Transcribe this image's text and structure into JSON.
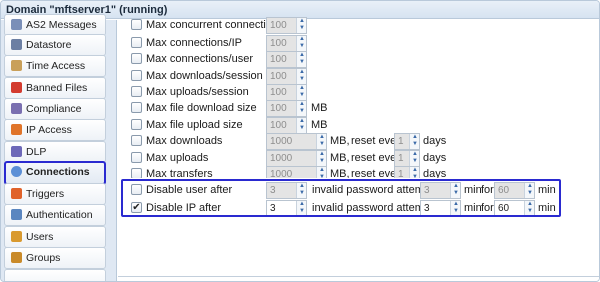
{
  "window": {
    "title": "Domain \"mftserver1\" (running)"
  },
  "sidebar": {
    "items": [
      {
        "label": "AS2 Messages",
        "icon": "as2-messages-icon",
        "color": "#7a8fb8"
      },
      {
        "label": "Datastore",
        "icon": "datastore-icon",
        "color": "#6c7fa3"
      },
      {
        "label": "Time Access",
        "icon": "time-access-icon",
        "color": "#c9a05a"
      },
      {
        "label": "Banned Files",
        "icon": "banned-files-icon",
        "color": "#d33b2f"
      },
      {
        "label": "Compliance",
        "icon": "compliance-icon",
        "color": "#7a6fb0"
      },
      {
        "label": "IP Access",
        "icon": "ip-access-icon",
        "color": "#e0742a"
      },
      {
        "label": "DLP",
        "icon": "dlp-icon",
        "color": "#6d68b8"
      },
      {
        "label": "Connections",
        "icon": "connections-icon",
        "color": "#5c8fd6",
        "active": true
      },
      {
        "label": "Triggers",
        "icon": "triggers-icon",
        "color": "#e0622a"
      },
      {
        "label": "Authentication",
        "icon": "authentication-icon",
        "color": "#5a86c0"
      },
      {
        "label": "Users",
        "icon": "users-icon",
        "color": "#d99a30"
      },
      {
        "label": "Groups",
        "icon": "groups-icon",
        "color": "#c98a2a"
      }
    ]
  },
  "settings": {
    "max_concurrent_connections": {
      "label": "Max concurrent connections",
      "value": "100"
    },
    "max_connections_ip": {
      "label": "Max connections/IP",
      "value": "100"
    },
    "max_connections_user": {
      "label": "Max connections/user",
      "value": "100"
    },
    "max_downloads_session": {
      "label": "Max downloads/session",
      "value": "100"
    },
    "max_uploads_session": {
      "label": "Max uploads/session",
      "value": "100"
    },
    "max_file_download_size": {
      "label": "Max file download size",
      "value": "100",
      "unit": "MB"
    },
    "max_file_upload_size": {
      "label": "Max file upload size",
      "value": "100",
      "unit": "MB"
    },
    "max_downloads": {
      "label": "Max downloads",
      "value": "1000",
      "unit": "MB,",
      "reset_label": "reset every",
      "reset_value": "1",
      "reset_unit": "days"
    },
    "max_uploads": {
      "label": "Max uploads",
      "value": "1000",
      "unit": "MB,",
      "reset_label": "reset every",
      "reset_value": "1",
      "reset_unit": "days"
    },
    "max_transfers": {
      "label": "Max transfers",
      "value": "1000",
      "unit": "MB,",
      "reset_label": "reset every",
      "reset_value": "1",
      "reset_unit": "days"
    },
    "disable_user_after": {
      "label": "Disable user after",
      "checked": false,
      "attempts": "3",
      "attempts_text": "invalid password attempts in",
      "window": "3",
      "window_unit": "min",
      "for_text": "for",
      "duration": "60",
      "duration_unit": "min"
    },
    "disable_ip_after": {
      "label": "Disable IP after",
      "checked": true,
      "check_glyph": "✔",
      "attempts": "3",
      "attempts_text": "invalid password attempts in",
      "window": "3",
      "window_unit": "min",
      "for_text": "for",
      "duration": "60",
      "duration_unit": "min"
    }
  },
  "colors": {
    "highlight": "#2a2ad0",
    "accent": "#3b6aa8"
  }
}
